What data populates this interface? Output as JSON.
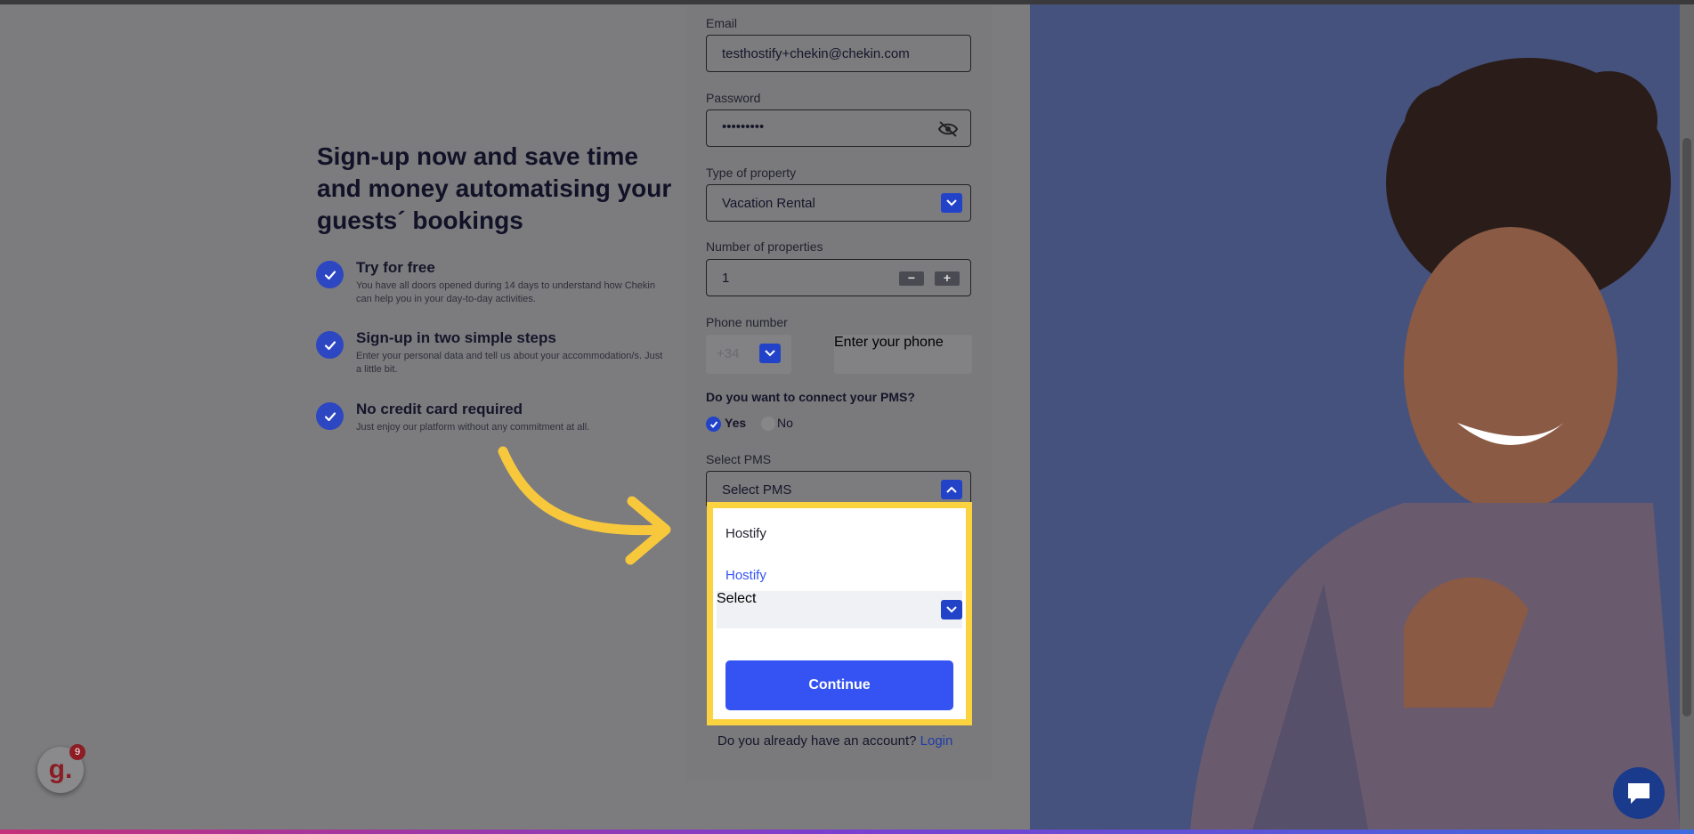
{
  "hero": {
    "title": "Sign-up now and save time and money automatising your guests´ bookings",
    "features": [
      {
        "title": "Try for free",
        "desc": "You have all doors opened during 14 days to understand how Chekin can help you in your day-to-day activities."
      },
      {
        "title": "Sign-up in two simple steps",
        "desc": "Enter your personal data and tell us about your accommodation/s. Just a little bit."
      },
      {
        "title": "No credit card required",
        "desc": "Just enjoy our platform without any commitment at all."
      }
    ]
  },
  "form": {
    "email_label": "Email",
    "email_value": "testhostify+chekin@chekin.com",
    "password_label": "Password",
    "password_value": "•••••••••",
    "property_type_label": "Type of property",
    "property_type_value": "Vacation Rental",
    "num_properties_label": "Number of properties",
    "num_properties_value": "1",
    "stepper_minus": "−",
    "stepper_plus": "+",
    "phone_label": "Phone number",
    "phone_prefix": "+34",
    "phone_placeholder": "Enter your phone",
    "pms_question": "Do you want to connect your PMS?",
    "pms_yes": "Yes",
    "pms_no": "No",
    "select_pms_label": "Select PMS",
    "select_pms_value": "Select PMS",
    "pms_options": [
      "Hostify",
      "Hostify"
    ],
    "sub_select_placeholder": "Select",
    "continue_label": "Continue",
    "login_prompt": "Do you already have an account?",
    "login_link": "Login"
  },
  "widgets": {
    "g_logo": "g.",
    "g_badge": "9"
  },
  "colors": {
    "accent": "#3553f2",
    "dark_accent": "#2243c8",
    "highlight": "#fbd341",
    "arrow": "#f8c83c"
  }
}
